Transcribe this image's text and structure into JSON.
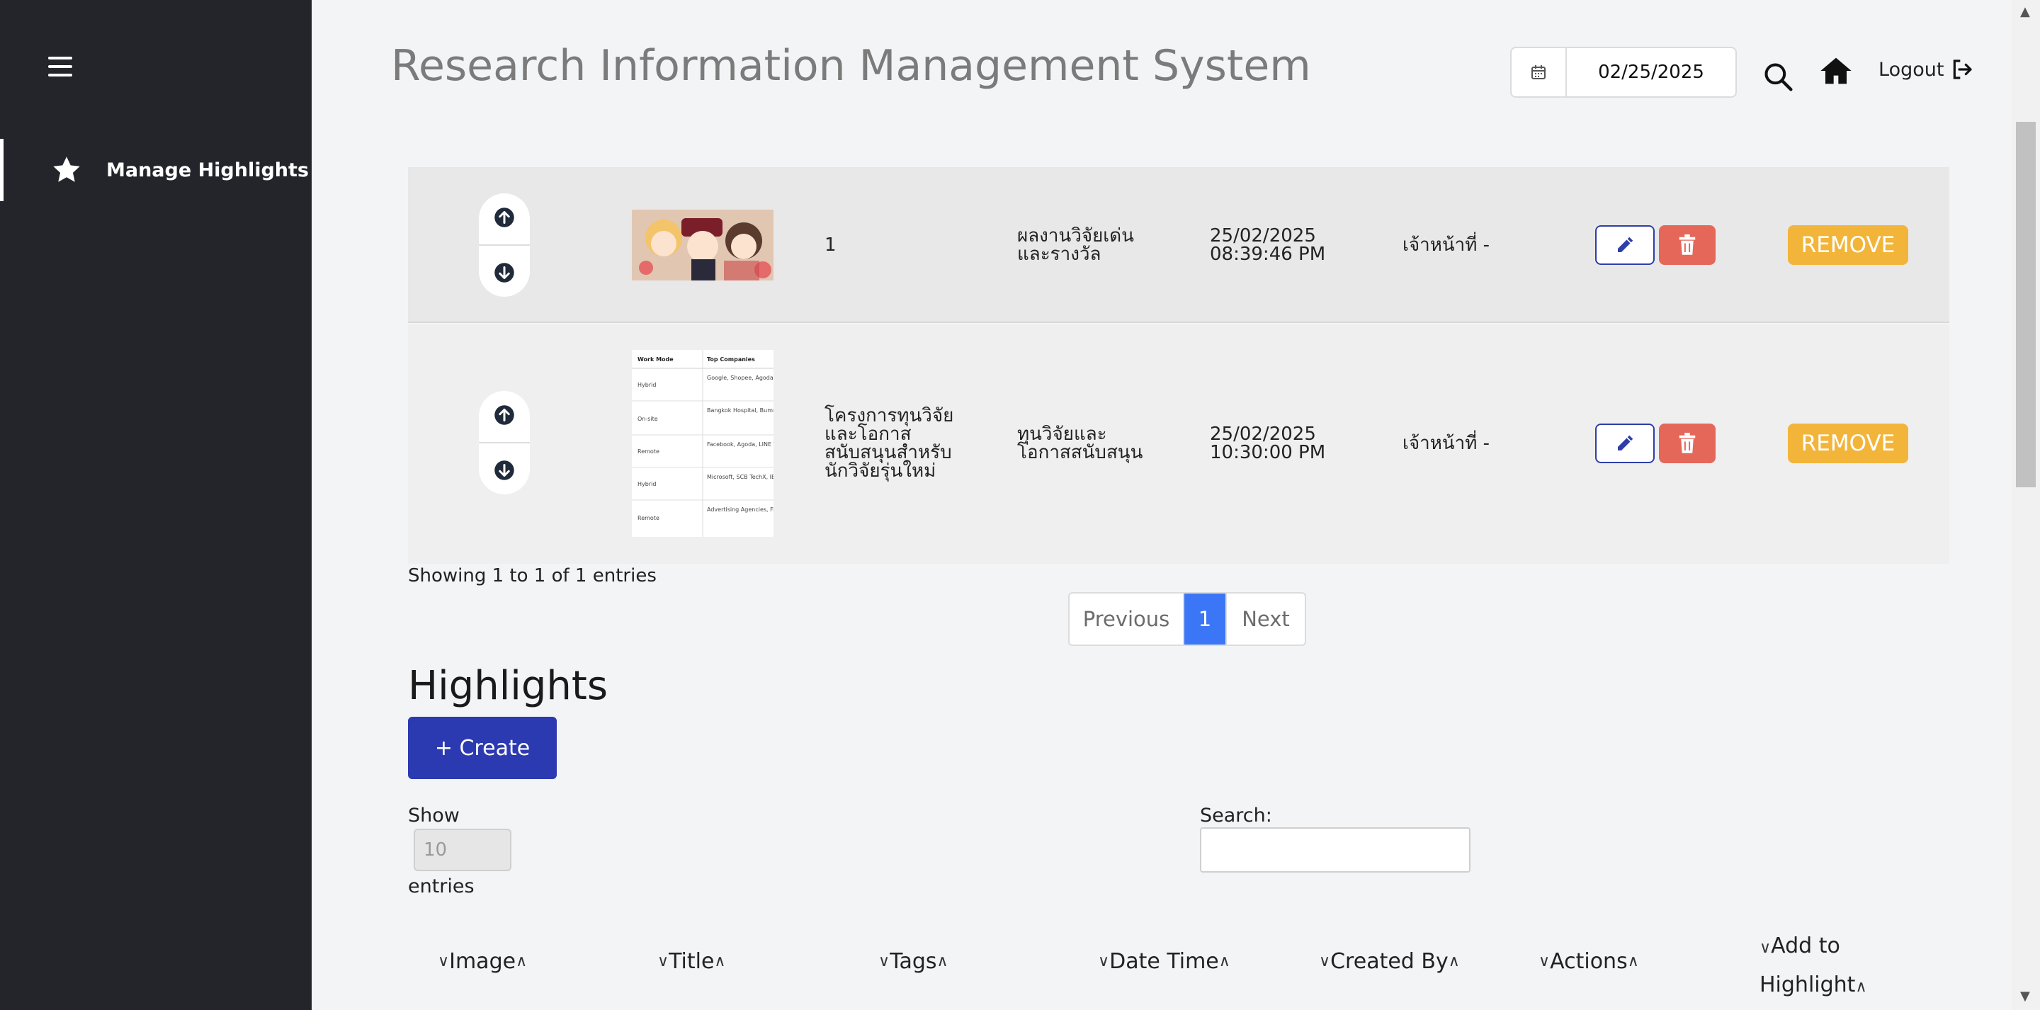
{
  "sidebar": {
    "items": [
      {
        "label": "Manage Highlights",
        "icon": "star-icon"
      }
    ]
  },
  "header": {
    "title": "Research Information Management System",
    "date": "02/25/2025",
    "logout_label": "Logout"
  },
  "top_table": {
    "rows": [
      {
        "order": "1",
        "title": "",
        "tags": "ผลงานวิจัยเด่น\nและรางวัล",
        "datetime": "25/02/2025\n08:39:46 PM",
        "created_by": "เจ้าหน้าที่ -",
        "remove_label": "REMOVE"
      },
      {
        "order": "",
        "title": "โครงการทุนวิจัย\nและโอกาส\nสนับสนุนสำหรับ\nนักวิจัยรุ่นใหม่",
        "tags": "ทุนวิจัยและ\nโอกาสสนับสนุน",
        "datetime": "25/02/2025\n10:30:00 PM",
        "created_by": "เจ้าหน้าที่ -",
        "remove_label": "REMOVE",
        "thumbnail_table": {
          "headers": [
            "Work Mode",
            "Top Companies"
          ],
          "rows": [
            [
              "Hybrid",
              "Google, Shopee, Agoda"
            ],
            [
              "On-site",
              "Bangkok Hospital, Bumrungrad, Samitivej"
            ],
            [
              "Remote",
              "Facebook, Agoda, LINE Thailand"
            ],
            [
              "Hybrid",
              "Microsoft, SCB TechX, IBM Thailand"
            ],
            [
              "Remote",
              "Advertising Agencies, Freelance, Game Studios"
            ]
          ]
        }
      }
    ],
    "showing": "Showing 1 to 1 of 1 entries",
    "pagination": {
      "previous": "Previous",
      "current": "1",
      "next": "Next"
    }
  },
  "highlights": {
    "title": "Highlights",
    "create_label": "+ Create",
    "show_label": "Show",
    "show_value": "10",
    "entries_label": "entries",
    "search_label": "Search:",
    "columns": [
      "Image",
      "Title",
      "Tags",
      "Date Time",
      "Created By",
      "Actions"
    ],
    "last_column_line1": "Add to",
    "last_column_line2": "Highlight"
  },
  "colors": {
    "sidebar_bg": "#24252a",
    "edit_border": "#2d3ea8",
    "delete_bg": "#e5675a",
    "remove_bg": "#f2b53a",
    "page_current_bg": "#3b76f6",
    "create_bg": "#2c3ab1"
  }
}
